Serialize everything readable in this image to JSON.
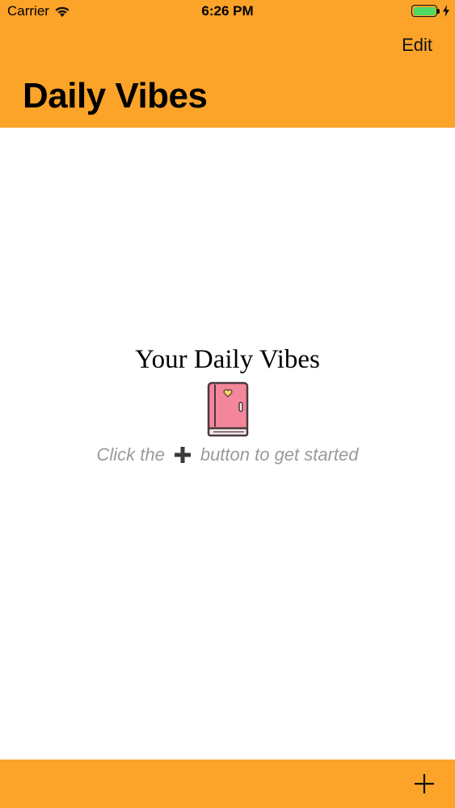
{
  "status_bar": {
    "carrier": "Carrier",
    "time": "6:26 PM",
    "wifi_icon": "wifi-icon",
    "battery_icon": "battery-icon",
    "battery_level": 1.0,
    "charging_icon": "bolt-icon"
  },
  "nav": {
    "edit_label": "Edit",
    "title": "Daily Vibes"
  },
  "empty_state": {
    "title": "Your Daily Vibes",
    "icon": "book-icon",
    "hint_before": "Click the",
    "hint_icon": "plus-icon",
    "hint_after": "button to get started"
  },
  "toolbar": {
    "add_icon": "plus-icon"
  },
  "colors": {
    "accent": "#fca32a",
    "book_pink": "#f4869b",
    "heart": "#f6d561",
    "hint_text": "#9a9a9a",
    "battery": "#4cd964"
  }
}
